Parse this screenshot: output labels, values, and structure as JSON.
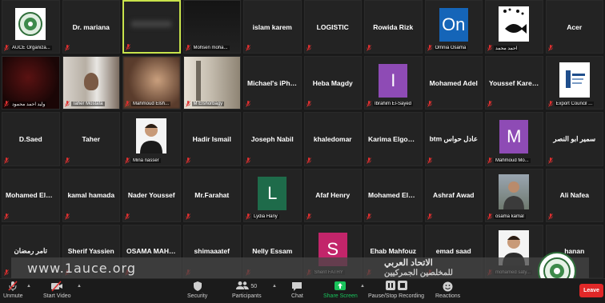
{
  "colors": {
    "active_border": "#c8e34b",
    "mute_red": "#e03030",
    "share_green": "#19c35b",
    "leave_red": "#e02828"
  },
  "tiles": [
    {
      "type": "logo",
      "caption": "AUCE Organiza..."
    },
    {
      "type": "name",
      "name": "Dr. mariana"
    },
    {
      "type": "blurred",
      "caption": ""
    },
    {
      "type": "photo-dark",
      "caption": "Mohsen moha..."
    },
    {
      "type": "name",
      "name": "islam karem"
    },
    {
      "type": "name",
      "name": "LOGISTIC"
    },
    {
      "type": "name",
      "name": "Rowida Rizk"
    },
    {
      "type": "avatar",
      "letter": "On",
      "color": "#1565b8",
      "caption": "Omnia Osama"
    },
    {
      "type": "image",
      "caption": "احمد محمد"
    },
    {
      "type": "name",
      "name": "Acer"
    },
    {
      "type": "photo-red",
      "caption": "وليد احمد محمود"
    },
    {
      "type": "photo-room",
      "caption": "Taher Mostafa"
    },
    {
      "type": "photo-blur",
      "caption": "Mahmoud Elsh..."
    },
    {
      "type": "photo-room2",
      "caption": "M Elshorbagy"
    },
    {
      "type": "name",
      "name": "Michael's iPhone"
    },
    {
      "type": "name",
      "name": "Heba Magdy"
    },
    {
      "type": "avatar",
      "letter": "I",
      "color": "#8e4bb5",
      "caption": "Ibrahim El-Sayed"
    },
    {
      "type": "name",
      "name": "Mohamed Adel"
    },
    {
      "type": "name",
      "name": "Youssef Kareem"
    },
    {
      "type": "image-doc",
      "caption": "Export Council ..."
    },
    {
      "type": "name",
      "name": "D.Saed"
    },
    {
      "type": "name",
      "name": "Taher"
    },
    {
      "type": "photo-person",
      "caption": "Mina nasser"
    },
    {
      "type": "name",
      "name": "Hadir Ismail"
    },
    {
      "type": "name",
      "name": "Joseph Nabil"
    },
    {
      "type": "name",
      "name": "khaledomar"
    },
    {
      "type": "name",
      "name": "Karima Elgohary"
    },
    {
      "type": "name",
      "name": "btm عادل حواس"
    },
    {
      "type": "avatar",
      "letter": "M",
      "color": "#8e4bb5",
      "caption": "Mahmoud Mo..."
    },
    {
      "type": "name",
      "name": "سمير ابو النصر"
    },
    {
      "type": "name",
      "name": "Mohamed Elsayed"
    },
    {
      "type": "name",
      "name": "kamal hamada"
    },
    {
      "type": "name",
      "name": "Nader Youssef"
    },
    {
      "type": "name",
      "name": "Mr.Farahat"
    },
    {
      "type": "avatar",
      "letter": "L",
      "color": "#1e6b4a",
      "caption": "Lydia Hany"
    },
    {
      "type": "name",
      "name": "Afaf Henry"
    },
    {
      "type": "name",
      "name": "Mohamed  Elsay..."
    },
    {
      "type": "name",
      "name": "Ashraf Awad"
    },
    {
      "type": "photo-outdoor",
      "caption": "osama kamal"
    },
    {
      "type": "name",
      "name": "Ali Nafea"
    },
    {
      "type": "name",
      "name": "تامر رمضان"
    },
    {
      "type": "name",
      "name": "Sherif Yassien"
    },
    {
      "type": "name",
      "name": "OSAMA  MAHM..."
    },
    {
      "type": "name",
      "name": "shimaaatef"
    },
    {
      "type": "name",
      "name": "Nelly Essam"
    },
    {
      "type": "avatar",
      "letter": "S",
      "color": "#c2256a",
      "caption": "Sherif FATHY"
    },
    {
      "type": "name",
      "name": "Ehab Mahfouz"
    },
    {
      "type": "name",
      "name": "emad saad"
    },
    {
      "type": "photo-person2",
      "caption": "mohamed saty..."
    },
    {
      "type": "name",
      "name": "hanan"
    }
  ],
  "banner": {
    "url": "www.1auce.org",
    "arabic_line1": "الاتحاد العربي",
    "arabic_line2": "للمخلصين الجمركيين"
  },
  "toolbar": {
    "unmute": "Unmute",
    "start_video": "Start Video",
    "security": "Security",
    "participants": "Participants",
    "participants_count": "50",
    "chat": "Chat",
    "share_screen": "Share Screen",
    "recording": "Pause/Stop Recording",
    "reactions": "Reactions",
    "leave": "Leave"
  }
}
